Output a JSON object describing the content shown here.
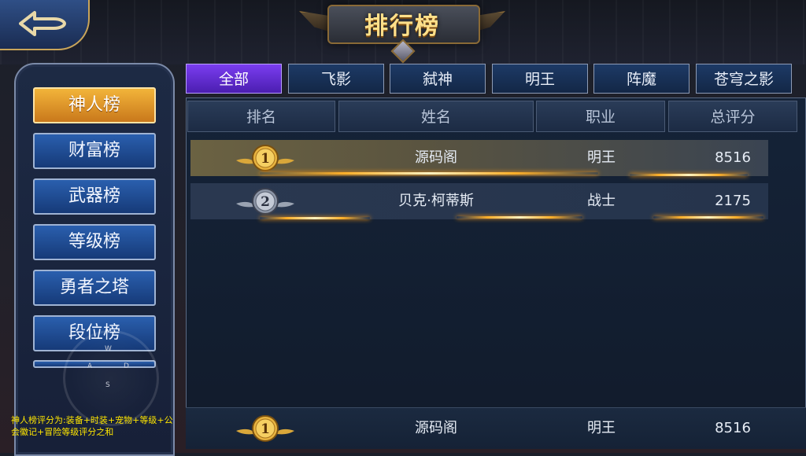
{
  "header": {
    "title": "排行榜",
    "back_icon": "back-arrow-icon"
  },
  "tabs": [
    {
      "label": "全部",
      "active": true
    },
    {
      "label": "飞影",
      "active": false
    },
    {
      "label": "弑神",
      "active": false
    },
    {
      "label": "明王",
      "active": false
    },
    {
      "label": "阵魔",
      "active": false
    },
    {
      "label": "苍穹之影",
      "active": false
    }
  ],
  "sidebar": {
    "items": [
      {
        "label": "神人榜",
        "active": true
      },
      {
        "label": "财富榜",
        "active": false
      },
      {
        "label": "武器榜",
        "active": false
      },
      {
        "label": "等级榜",
        "active": false
      },
      {
        "label": "勇者之塔",
        "active": false
      },
      {
        "label": "段位榜",
        "active": false
      }
    ],
    "rule_note": "神人榜评分为:装备+时装+宠物+等级+公会徽记+冒险等级评分之和"
  },
  "joystick": {
    "up": "W",
    "left": "A",
    "right": "D",
    "down": "S"
  },
  "table": {
    "columns": [
      "排名",
      "姓名",
      "职业",
      "总评分"
    ],
    "rows": [
      {
        "rank": "1",
        "name": "源码阁",
        "class": "明王",
        "score": "8516"
      },
      {
        "rank": "2",
        "name": "贝克·柯蒂斯",
        "class": "战士",
        "score": "2175"
      }
    ]
  },
  "my_rank": {
    "rank": "1",
    "name": "源码阁",
    "class": "明王",
    "score": "8516"
  },
  "colors": {
    "gold_medal": "#d9a73a",
    "silver_medal": "#9aa3b2",
    "active_tab": "#6a30e0",
    "active_menu": "#e8a030",
    "menu_blue": "#1f4c93"
  }
}
